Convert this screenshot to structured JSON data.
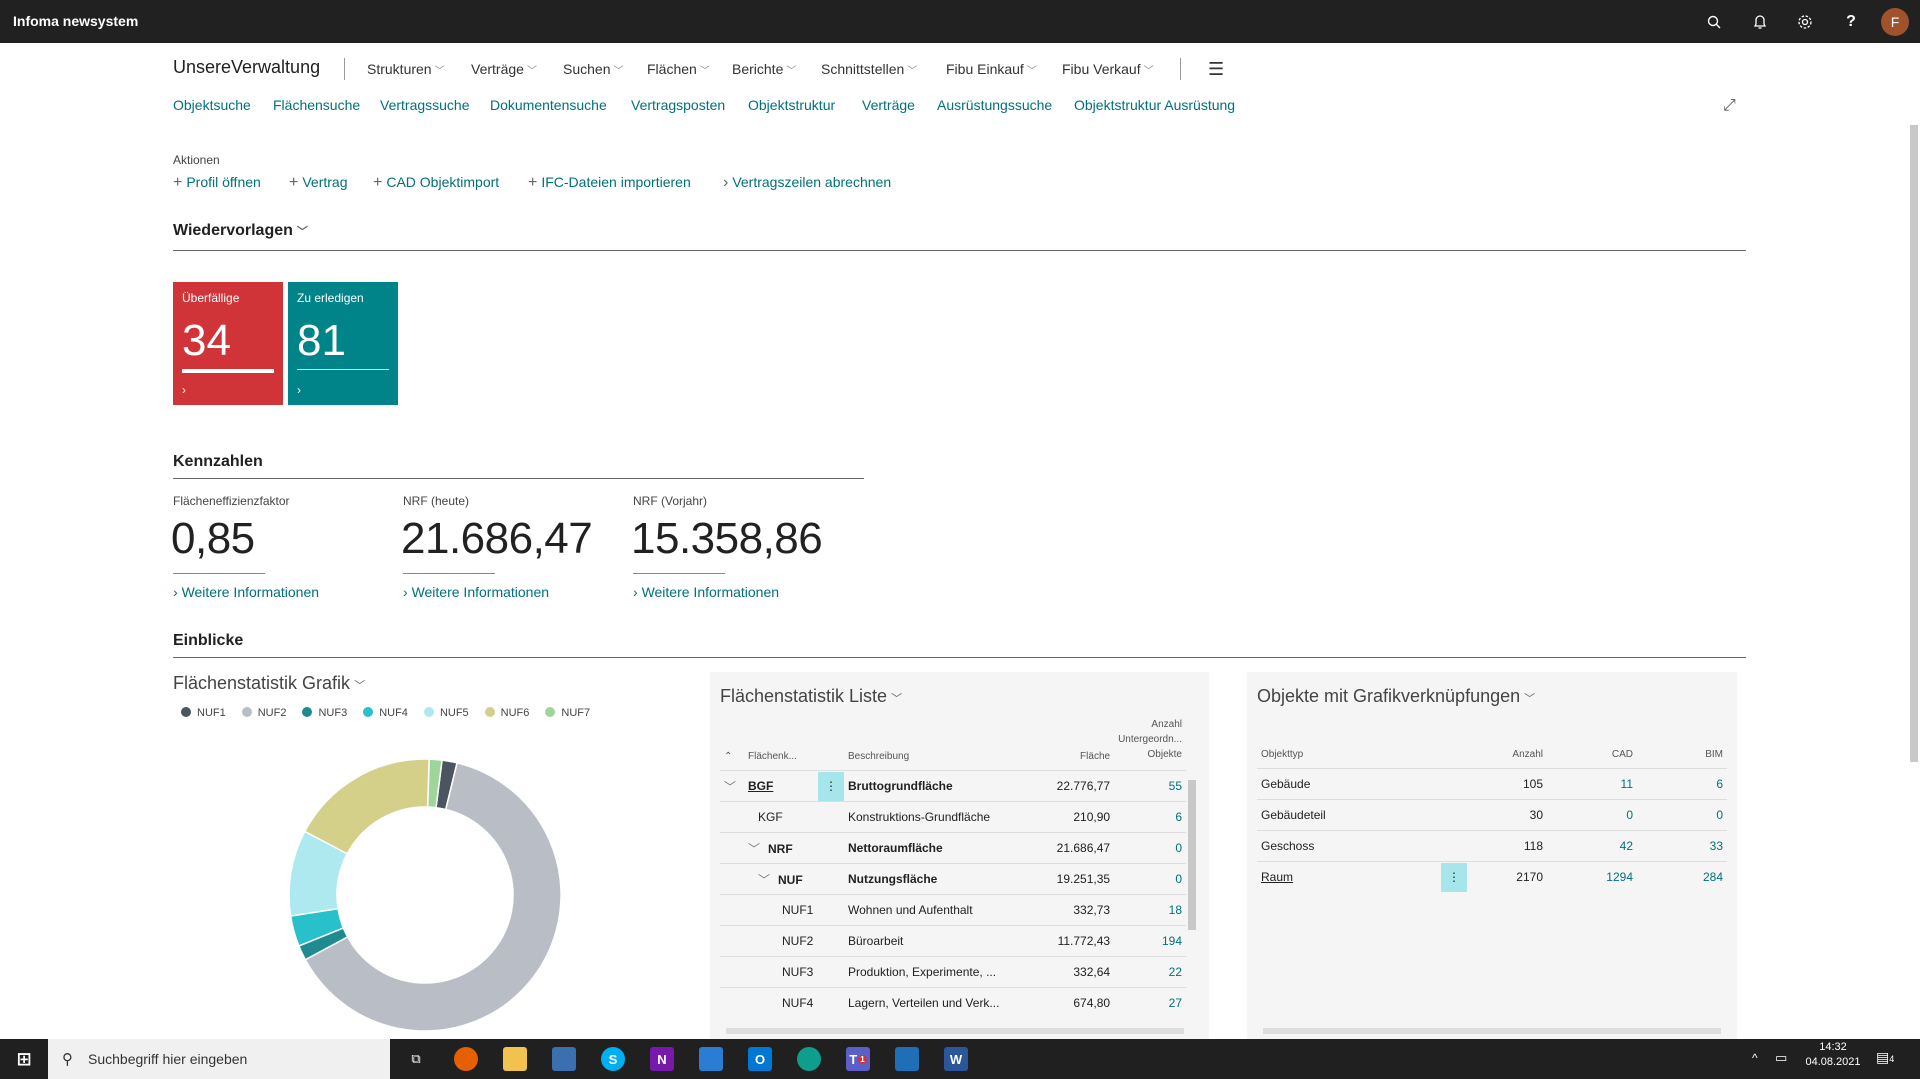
{
  "topbar": {
    "brand": "Infoma newsystem",
    "avatar": "F"
  },
  "nav": {
    "app_name": "UnsereVerwaltung",
    "menus": [
      "Strukturen",
      "Verträge",
      "Suchen",
      "Flächen",
      "Berichte",
      "Schnittstellen",
      "Fibu Einkauf",
      "Fibu Verkauf"
    ],
    "links": [
      "Objektsuche",
      "Flächensuche",
      "Vertragssuche",
      "Dokumentensuche",
      "Vertragsposten",
      "Objektstruktur",
      "Verträge",
      "Ausrüstungssuche",
      "Objektstruktur Ausrüstung"
    ]
  },
  "actions": {
    "label": "Aktionen",
    "items": [
      "Profil öffnen",
      "Vertrag",
      "CAD Objektimport",
      "IFC-Dateien importieren",
      "Vertragszeilen abrechnen"
    ]
  },
  "wiedervorlagen": {
    "title": "Wiedervorlagen",
    "tiles": [
      {
        "title": "Überfällige",
        "value": "34",
        "color": "#d13438"
      },
      {
        "title": "Zu erledigen",
        "value": "81",
        "color": "#008489"
      }
    ]
  },
  "kennzahlen": {
    "title": "Kennzahlen",
    "items": [
      {
        "label": "Flächeneffizienzfaktor",
        "value": "0,85",
        "more": "Weitere Informationen"
      },
      {
        "label": "NRF (heute)",
        "value": "21.686,47",
        "more": "Weitere Informationen"
      },
      {
        "label": "NRF (Vorjahr)",
        "value": "15.358,86",
        "more": "Weitere Informationen"
      }
    ]
  },
  "einblicke": {
    "title": "Einblicke",
    "chart_title": "Flächenstatistik Grafik",
    "chart_data": {
      "type": "pie",
      "categories": [
        "NUF1",
        "NUF2",
        "NUF3",
        "NUF4",
        "NUF5",
        "NUF6",
        "NUF7"
      ],
      "values": [
        332.73,
        11772.43,
        332.64,
        674.8,
        1900,
        3300,
        280
      ],
      "colors": [
        "#4a5560",
        "#b9bec6",
        "#1f8a8f",
        "#27c0cb",
        "#aee9ef",
        "#d4d08a",
        "#9fd49b"
      ],
      "title": "",
      "xlabel": "",
      "ylabel": ""
    },
    "list": {
      "title": "Flächenstatistik Liste",
      "headers": [
        "Flächenk...",
        "Beschreibung",
        "Fläche",
        "Anzahl",
        "Untergeordn...",
        "Objekte"
      ],
      "rows": [
        {
          "code": "BGF",
          "desc": "Bruttogrundfläche",
          "area": "22.776,77",
          "count": "55"
        },
        {
          "code": "KGF",
          "desc": "Konstruktions-Grundfläche",
          "area": "210,90",
          "count": "6"
        },
        {
          "code": "NRF",
          "desc": "Nettoraumfläche",
          "area": "21.686,47",
          "count": "0"
        },
        {
          "code": "NUF",
          "desc": "Nutzungsfläche",
          "area": "19.251,35",
          "count": "0"
        },
        {
          "code": "NUF1",
          "desc": "Wohnen und Aufenthalt",
          "area": "332,73",
          "count": "18"
        },
        {
          "code": "NUF2",
          "desc": "Büroarbeit",
          "area": "11.772,43",
          "count": "194"
        },
        {
          "code": "NUF3",
          "desc": "Produktion, Experimente, ...",
          "area": "332,64",
          "count": "22"
        },
        {
          "code": "NUF4",
          "desc": "Lagern, Verteilen und Verk...",
          "area": "674,80",
          "count": "27"
        }
      ]
    },
    "objects": {
      "title": "Objekte mit Grafikverknüpfungen",
      "headers": [
        "Objekttyp",
        "Anzahl",
        "CAD",
        "BIM"
      ],
      "rows": [
        {
          "type": "Gebäude",
          "count": "105",
          "cad": "11",
          "bim": "6"
        },
        {
          "type": "Gebäudeteil",
          "count": "30",
          "cad": "0",
          "bim": "0"
        },
        {
          "type": "Geschoss",
          "count": "118",
          "cad": "42",
          "bim": "33"
        },
        {
          "type": "Raum",
          "count": "2170",
          "cad": "1294",
          "bim": "284"
        }
      ]
    }
  },
  "taskbar": {
    "search_placeholder": "Suchbegriff hier eingeben",
    "time": "14:32",
    "date": "04.08.2021",
    "notif_count": "4",
    "teams_badge": "1"
  }
}
